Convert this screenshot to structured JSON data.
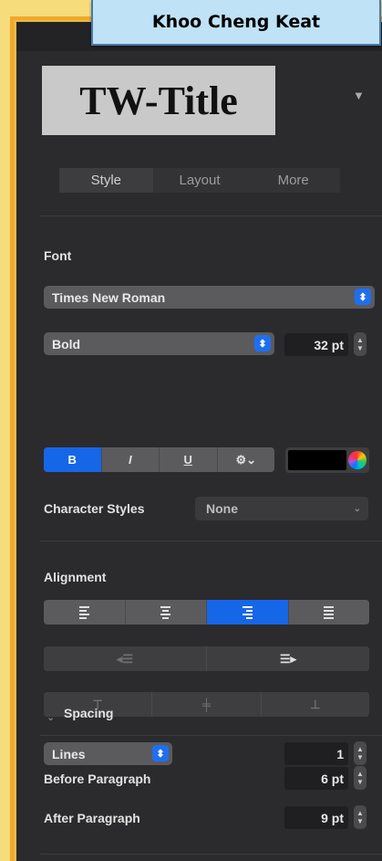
{
  "author": "Khoo Cheng Keat",
  "title_style": {
    "name": "TW-Title",
    "menu_icon": "chevron-down-icon"
  },
  "tabs": [
    "Style",
    "Layout",
    "More"
  ],
  "active_tab": "Style",
  "font": {
    "section_label": "Font",
    "family": "Times New Roman",
    "typeface": "Bold",
    "size": "32 pt",
    "buttons": {
      "bold": "B",
      "italic": "I",
      "underline": "U",
      "options_icon": "gear-icon"
    },
    "text_color": "#000000",
    "character_styles_label": "Character Styles",
    "character_style": "None"
  },
  "alignment": {
    "section_label": "Alignment",
    "horizontal_icons": [
      "align-left-icon",
      "align-center-icon",
      "align-right-icon",
      "justify-icon"
    ],
    "selected": "align-right-icon",
    "indent_icons": [
      "decrease-indent-icon",
      "increase-indent-icon"
    ],
    "vertical_icons": [
      "align-top-icon",
      "align-middle-icon",
      "align-bottom-icon"
    ]
  },
  "spacing": {
    "section_label": "Spacing",
    "line_mode": "Lines",
    "line_value": "1",
    "before_label": "Before Paragraph",
    "before_value": "6 pt",
    "after_label": "After Paragraph",
    "after_value": "9 pt"
  },
  "colors": {
    "accent": "#1666e8",
    "panel": "#2b2b2d",
    "badge": "#bfe2f6"
  }
}
